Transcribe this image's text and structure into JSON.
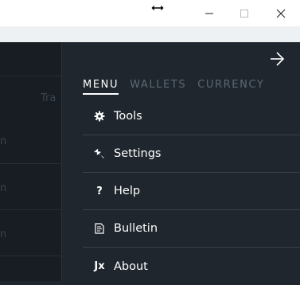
{
  "window": {
    "controls": {
      "minimize_icon": "minimize-icon",
      "maximize_icon": "maximize-icon",
      "close_icon": "close-icon"
    }
  },
  "background": {
    "partial_label": "Tra",
    "row_fragments": [
      "n",
      "n",
      "n"
    ]
  },
  "drawer": {
    "tabs": [
      {
        "label": "MENU",
        "active": true
      },
      {
        "label": "WALLETS",
        "active": false
      },
      {
        "label": "CURRENCY",
        "active": false
      }
    ],
    "menu_items": [
      {
        "label": "Tools",
        "icon": "gear-icon"
      },
      {
        "label": "Settings",
        "icon": "wrench-icon"
      },
      {
        "label": "Help",
        "icon": "question-icon"
      },
      {
        "label": "Bulletin",
        "icon": "document-icon"
      },
      {
        "label": "About",
        "icon": "jx-logo-icon",
        "icon_text": "Jx"
      }
    ]
  },
  "colors": {
    "drawer_bg": "#1f262d",
    "active_tab": "#ffffff",
    "inactive_tab": "#5c6873",
    "divider": "#38424c"
  }
}
